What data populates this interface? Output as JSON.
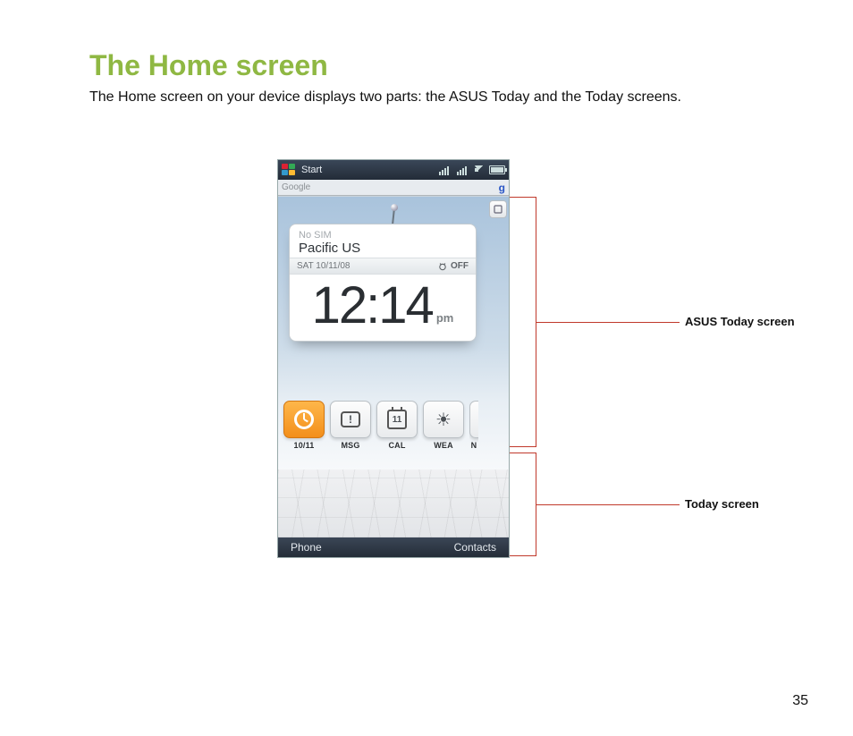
{
  "page": {
    "title": "The Home screen",
    "description": "The Home screen on your device displays two parts: the ASUS Today and the Today screens.",
    "number": "35"
  },
  "callouts": {
    "asus_today": "ASUS Today screen",
    "today": "Today screen"
  },
  "phone": {
    "status": {
      "start": "Start"
    },
    "google": {
      "placeholder": "Google"
    },
    "card": {
      "no_sim": "No SIM",
      "timezone": "Pacific US",
      "date": "SAT 10/11/08",
      "alarm": "OFF",
      "time": "12:14",
      "ampm": "pm"
    },
    "widgets": [
      {
        "label": "10/11",
        "selected": true,
        "kind": "clock"
      },
      {
        "label": "MSG",
        "selected": false,
        "kind": "message"
      },
      {
        "label": "CAL",
        "selected": false,
        "kind": "calendar",
        "day": "11"
      },
      {
        "label": "WEA",
        "selected": false,
        "kind": "weather"
      },
      {
        "label": "N",
        "selected": false,
        "kind": "cut"
      }
    ],
    "softkeys": {
      "left": "Phone",
      "right": "Contacts"
    }
  }
}
